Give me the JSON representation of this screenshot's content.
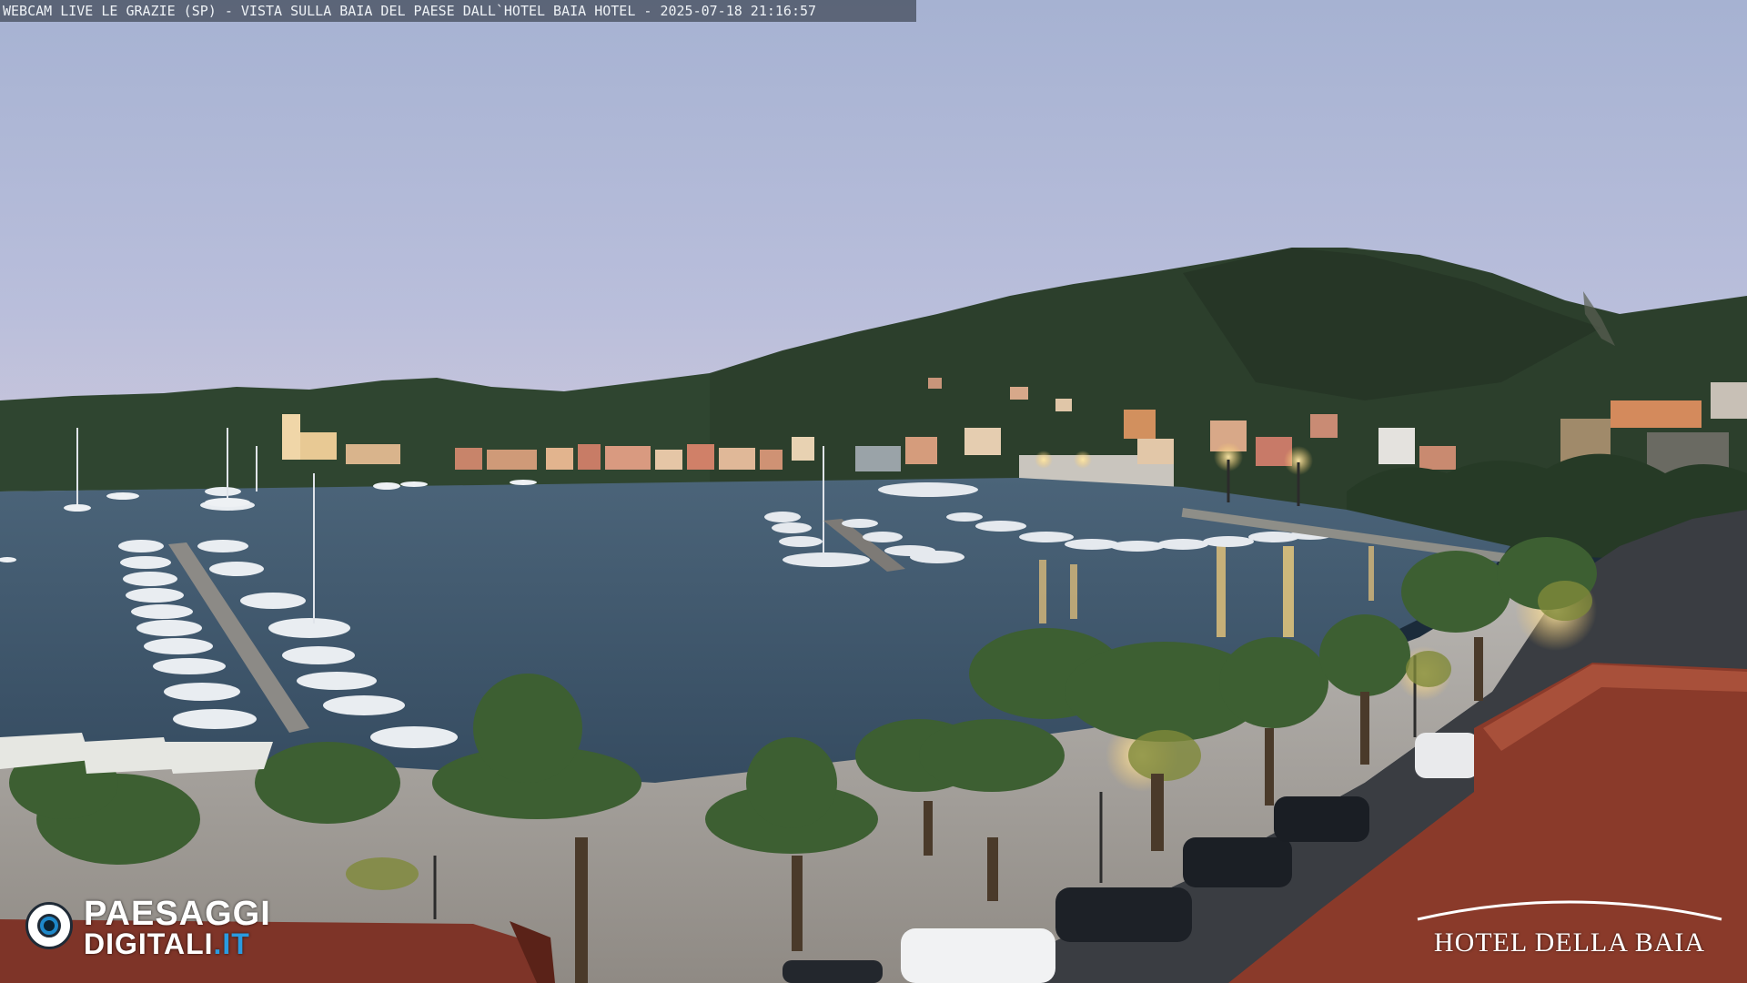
{
  "overlay": {
    "caption": "WEBCAM LIVE LE GRAZIE (SP) - VISTA SULLA BAIA DEL PAESE DALL`HOTEL BAIA HOTEL - 2025-07-18 21:16:57"
  },
  "logos": {
    "left_line1": "PAESAGGI",
    "left_line2_main": "DIGITALI",
    "left_line2_tld": ".IT",
    "right_text": "HOTEL DELLA BAIA"
  },
  "colors": {
    "sky_top": "#aab4d2",
    "sky_bottom": "#c9c6dc",
    "water": "#3e556b",
    "brand_blue": "#1e88c9"
  }
}
